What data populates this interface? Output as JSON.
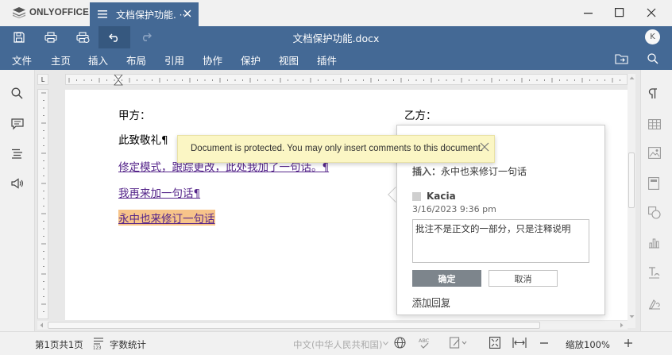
{
  "app": {
    "name": "ONLYOFFICE"
  },
  "tab": {
    "label": "文档保护功能. ···"
  },
  "header": {
    "doc_title": "文档保护功能.docx",
    "avatar_initial": "K",
    "accent": "#446995"
  },
  "menu": {
    "tabs": [
      "文件",
      "主页",
      "插入",
      "布局",
      "引用",
      "协作",
      "保护",
      "视图",
      "插件"
    ]
  },
  "ruler": {
    "corner_label": "L"
  },
  "document": {
    "party_a": "甲方：",
    "party_b": "乙方：",
    "line1": "此致敬礼¶",
    "line2": "修定模式，跟踪更改，此处我加了一句话。¶",
    "line3": "我再来加一句话¶",
    "line4": "永中也来修订一句话"
  },
  "banner": {
    "text": "Document is protected. You may only insert comments to this document."
  },
  "comment": {
    "insert_label": "插入：",
    "insert_text": "永中也来修订一句话",
    "author": "Kacia",
    "date": "3/16/2023 9:36 pm",
    "text": "批注不是正文的一部分，只是注释说明",
    "ok_label": "确定",
    "cancel_label": "取消",
    "add_reply_label": "添加回复"
  },
  "status": {
    "page_info": "第1页共1页",
    "word_count": "字数统计",
    "language": "中文(中华人民共和国)",
    "zoom": "缩放100%"
  }
}
